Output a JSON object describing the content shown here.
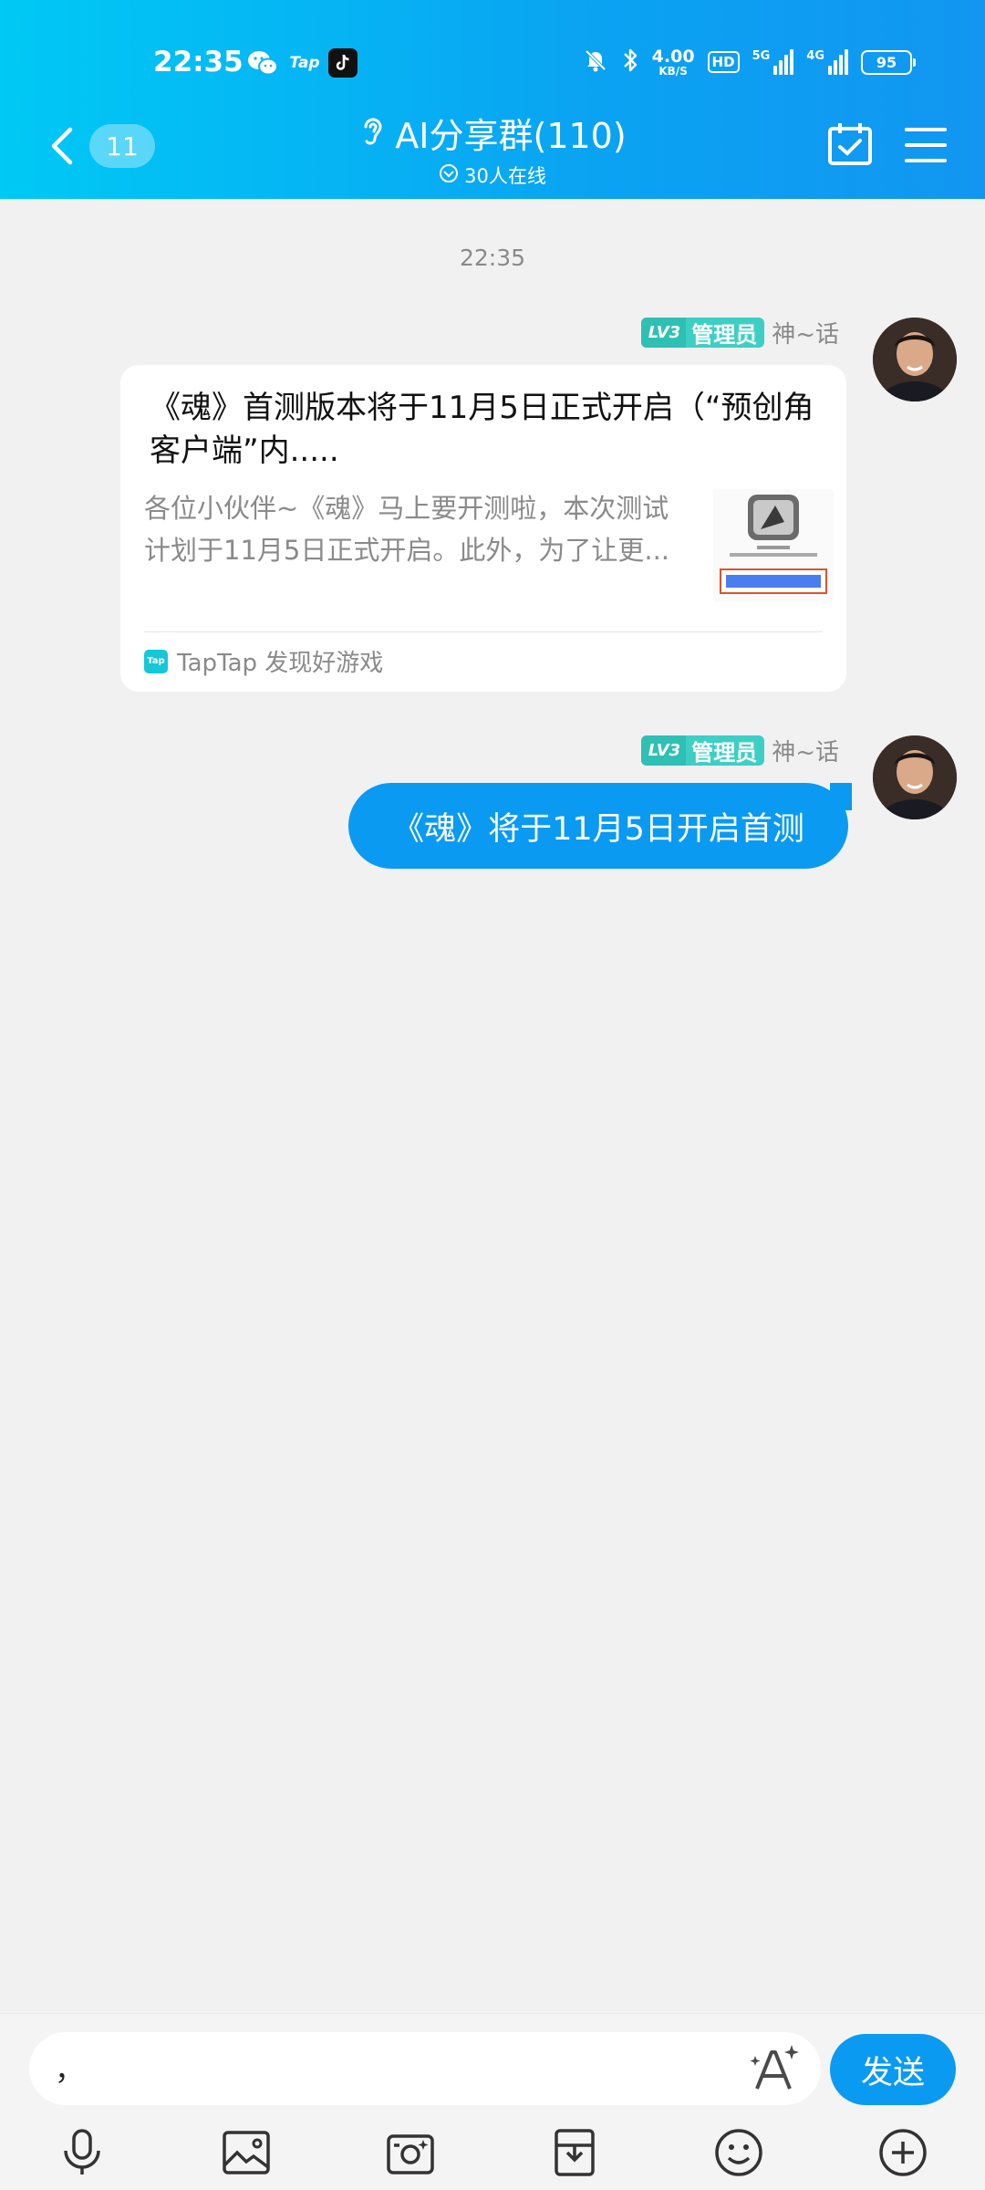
{
  "status_bar": {
    "time": "22:35",
    "tap_label": "Tap",
    "speed_value": "4.00",
    "speed_unit": "KB/S",
    "hd_label": "HD",
    "net1_label": "5G",
    "net2_label": "4G",
    "battery": "95"
  },
  "header": {
    "unread_count": "11",
    "title": "AI分享群(110)",
    "online": "30人在线"
  },
  "chat": {
    "timestamp": "22:35",
    "messages": [
      {
        "level": "LV3",
        "role": "管理员",
        "sender": "神~话",
        "card": {
          "title": "《魂》首测版本将于11月5日正式开启（“预创角客户端”内.....",
          "description": "各位小伙伴~《魂》马上要开测啦，本次测试计划于11月5日正式开启。此外，为了让更...",
          "source": "TapTap 发现好游戏",
          "source_icon_label": "Tap"
        }
      },
      {
        "level": "LV3",
        "role": "管理员",
        "sender": "神~话",
        "text": "《魂》将于11月5日开启首测"
      }
    ]
  },
  "input": {
    "value": "，",
    "send_label": "发送"
  },
  "toolbar": {
    "icons": [
      "microphone-icon",
      "image-icon",
      "camera-icon",
      "file-icon",
      "emoji-icon",
      "plus-icon"
    ]
  },
  "colors": {
    "accent": "#0a9af2",
    "header_start": "#00c9f5",
    "level_badge": "#3ecfc4"
  }
}
